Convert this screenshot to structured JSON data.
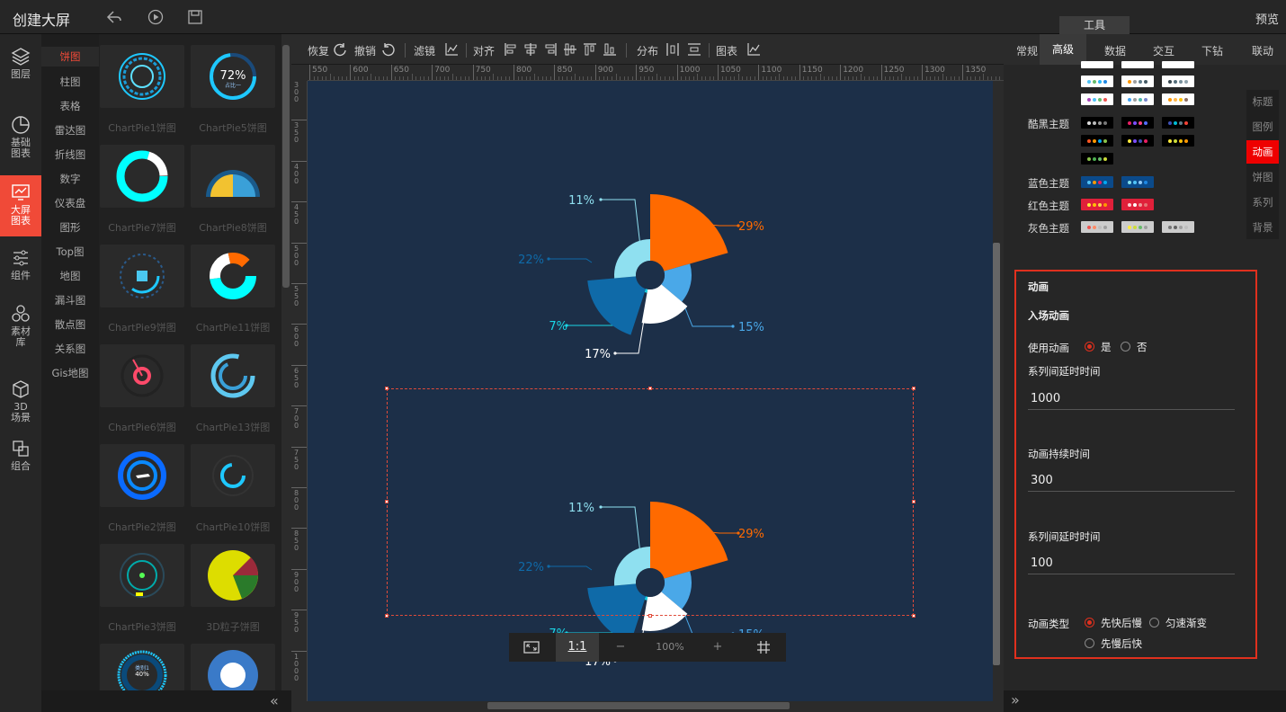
{
  "app": {
    "title": "创建大屏",
    "preview": "预览",
    "tools_tab": "工具"
  },
  "leftnav": [
    {
      "label": "图层",
      "icon": "layers-icon"
    },
    {
      "label": "基础\n图表",
      "icon": "pie-outline-icon"
    },
    {
      "label": "大屏\n图表",
      "icon": "monitor-chart-icon",
      "active": true
    },
    {
      "label": "组件",
      "icon": "sliders-icon"
    },
    {
      "label": "素材\n库",
      "icon": "assets-icon"
    },
    {
      "label": "3D\n场景",
      "icon": "cube-icon"
    },
    {
      "label": "组合",
      "icon": "group-icon"
    }
  ],
  "categories": [
    "饼图",
    "柱图",
    "表格",
    "雷达图",
    "折线图",
    "数字",
    "仪表盘",
    "图形",
    "Top图",
    "地图",
    "漏斗图",
    "散点图",
    "关系图",
    "Gis地图"
  ],
  "thumbnails": [
    {
      "label": "ChartPie1饼图"
    },
    {
      "label": "ChartPie5饼图",
      "value": "72%",
      "sub": "占比一"
    },
    {
      "label": "ChartPie7饼图"
    },
    {
      "label": "ChartPie8饼图"
    },
    {
      "label": "ChartPie9饼图"
    },
    {
      "label": "ChartPie11饼图"
    },
    {
      "label": "ChartPie6饼图"
    },
    {
      "label": "ChartPie13饼图"
    },
    {
      "label": "ChartPie2饼图"
    },
    {
      "label": "ChartPie10饼图"
    },
    {
      "label": "ChartPie3饼图"
    },
    {
      "label": "3D粒子饼图"
    },
    {
      "label": "",
      "value": "40%",
      "sub": "类别1"
    },
    {
      "label": ""
    }
  ],
  "toolbar": {
    "redo": "恢复",
    "undo": "撤销",
    "filter": "滤镜",
    "align": "对齐",
    "distribute": "分布",
    "chart": "图表"
  },
  "ruler": {
    "h": [
      "550",
      "600",
      "650",
      "700",
      "750",
      "800",
      "850",
      "900",
      "950",
      "1000",
      "1050",
      "1100",
      "1150",
      "1200",
      "1250",
      "1300",
      "1350"
    ],
    "v": [
      "300",
      "350",
      "400",
      "450",
      "500",
      "550",
      "600",
      "650",
      "700",
      "750",
      "800",
      "850",
      "900",
      "950",
      "1000"
    ]
  },
  "zoom": {
    "fit": "⤢",
    "one": "1:1",
    "minus": "−",
    "value": "100%",
    "plus": "+",
    "grid": "#"
  },
  "right_tabs": [
    "常规",
    "高级",
    "数据",
    "交互",
    "下钻",
    "联动"
  ],
  "right_active": "高级",
  "themes": [
    {
      "label": "",
      "rows": [
        [
          [
            "#999",
            "#bbb",
            "#ddd"
          ],
          [
            "#bbb",
            "#ccc",
            "#ddd"
          ],
          [
            "#999",
            "#bbb",
            "#ccc"
          ]
        ],
        [
          [
            "#4fc3f7",
            "#66bb6a",
            "#29b6f6",
            "#1e88e5"
          ],
          [
            "#ff9800",
            "#9e9e9e",
            "#607d8b",
            "#455a64"
          ],
          [
            "#37474f",
            "#546e7a",
            "#78909c",
            "#90a4ae"
          ]
        ],
        [
          [
            "#ab47bc",
            "#4fc3f7",
            "#66bb6a",
            "#ef5350"
          ],
          [
            "#42a5f5",
            "#9e9e9e",
            "#4db6ac",
            "#7986cb"
          ],
          [
            "#ff9800",
            "#ffb74d",
            "#ffc107",
            "#8d6e63"
          ]
        ]
      ]
    },
    {
      "label": "酷黑主题",
      "rows": [
        [
          [
            "#ddd",
            "#bbb",
            "#999",
            "#777"
          ],
          [
            "#e91e63",
            "#7c4dff",
            "#ff4081",
            "#536dfe"
          ],
          [
            "#3f51b5",
            "#00bcd4",
            "#607d8b",
            "#f44336"
          ]
        ],
        [
          [
            "#ff5722",
            "#ff9800",
            "#03a9f4",
            "#8bc34a"
          ],
          [
            "#ffeb3b",
            "#7c4dff",
            "#3f51b5",
            "#e91e63"
          ],
          [
            "#ffeb3b",
            "#cddc39",
            "#ffc107",
            "#ff9800"
          ]
        ],
        [
          [
            "#8bc34a",
            "#4caf50",
            "#66bb6a",
            "#cddc39"
          ]
        ]
      ]
    },
    {
      "label": "蓝色主题",
      "rows": [
        [
          [
            "#4fc3f7",
            "#ff9800",
            "#e91e63",
            "#03a9f4"
          ],
          [
            "#80deea",
            "#4fc3f7",
            "#90caf9",
            "#1e88e5"
          ]
        ]
      ]
    },
    {
      "label": "红色主题",
      "rows": [
        [
          [
            "#ffeb3b",
            "#ffc107",
            "#ffd54f",
            "#ff9800"
          ],
          [
            "#ffcdd2",
            "#fff",
            "#ef9a9a",
            "#e57373"
          ]
        ]
      ]
    },
    {
      "label": "灰色主题",
      "rows": [
        [
          [
            "#ef5350",
            "#ff8a65",
            "#bdbdbd",
            "#9e9e9e"
          ],
          [
            "#ffeb3b",
            "#cddc39",
            "#66bb6a",
            "#9e9e9e"
          ],
          [
            "#757575",
            "#616161",
            "#9e9e9e",
            "#bdbdbd"
          ]
        ]
      ]
    }
  ],
  "side_tabs": [
    "标题",
    "图例",
    "动画",
    "饼图",
    "系列",
    "背景"
  ],
  "side_active": "动画",
  "animation": {
    "section": "动画",
    "entry": "入场动画",
    "use_label": "使用动画",
    "yes": "是",
    "no": "否",
    "delay_label": "系列间延时时间",
    "delay_value": "1000",
    "duration_label": "动画持续时间",
    "duration_value": "300",
    "delay2_label": "系列间延时时间",
    "delay2_value": "100",
    "type_label": "动画类型",
    "type_opt1": "先快后慢",
    "type_opt2": "匀速渐变",
    "type_opt3": "先慢后快"
  },
  "chart_data": [
    {
      "type": "pie",
      "subtype": "rose",
      "slices": [
        {
          "value": 29,
          "label": "29%",
          "color": "#ff6a00"
        },
        {
          "value": 15,
          "label": "15%",
          "color": "#4aa8e8"
        },
        {
          "value": 17,
          "label": "17%",
          "color": "#ffffff"
        },
        {
          "value": 7,
          "label": "7%",
          "color": "#1ad6e6"
        },
        {
          "value": 22,
          "label": "22%",
          "color": "#0f6aa8"
        },
        {
          "value": 11,
          "label": "11%",
          "color": "#8fe0f0"
        }
      ]
    },
    {
      "type": "pie",
      "subtype": "rose",
      "slices": [
        {
          "value": 29,
          "label": "29%",
          "color": "#ff6a00"
        },
        {
          "value": 15,
          "label": "15%",
          "color": "#4aa8e8"
        },
        {
          "value": 17,
          "label": "17%",
          "color": "#ffffff"
        },
        {
          "value": 7,
          "label": "7%",
          "color": "#1ad6e6"
        },
        {
          "value": 22,
          "label": "22%",
          "color": "#0f6aa8"
        },
        {
          "value": 11,
          "label": "11%",
          "color": "#8fe0f0"
        }
      ]
    }
  ]
}
